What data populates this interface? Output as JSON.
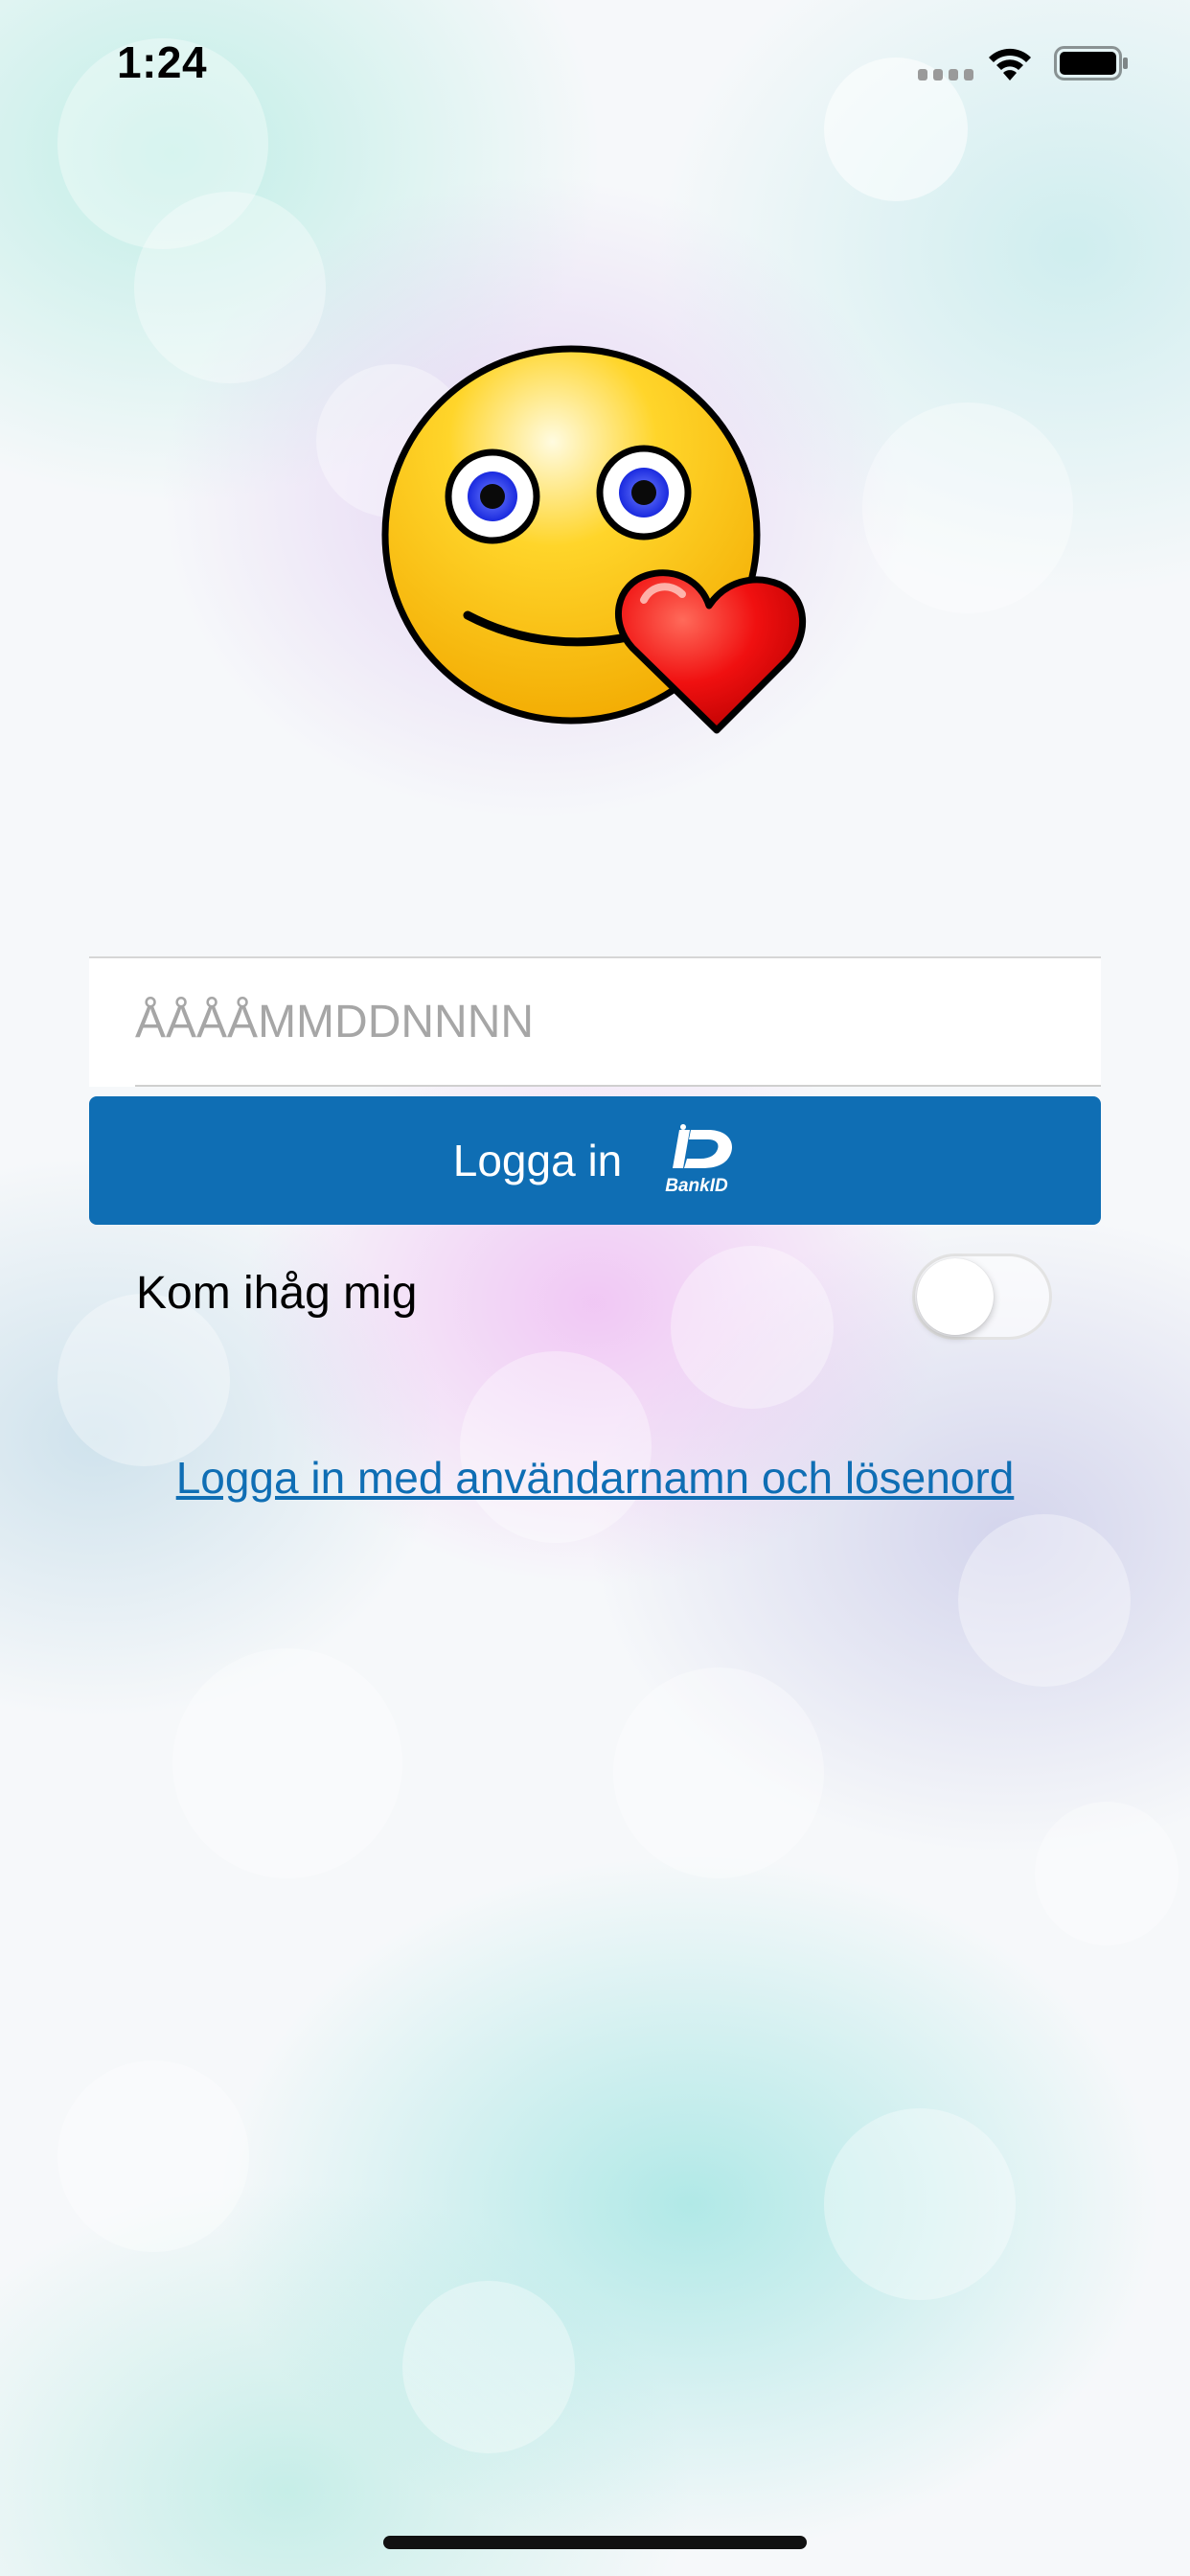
{
  "status_bar": {
    "time": "1:24"
  },
  "login": {
    "pnr_placeholder": "ÅÅÅÅMMDDNNNN",
    "pnr_value": "",
    "bankid_button_label": "Logga in",
    "bankid_logo_text": "BankID",
    "remember_me_label": "Kom ihåg mig",
    "remember_me_on": false,
    "password_login_link": "Logga in med användarnamn och lösenord"
  },
  "colors": {
    "accent": "#0f6eb4",
    "button_text": "#ffffff",
    "placeholder": "#a6a6a6"
  },
  "icons": {
    "logo": "smiley-with-heart-icon",
    "bankid": "bankid-icon",
    "wifi": "wifi-icon",
    "battery": "battery-icon",
    "signal": "signal-icon"
  }
}
